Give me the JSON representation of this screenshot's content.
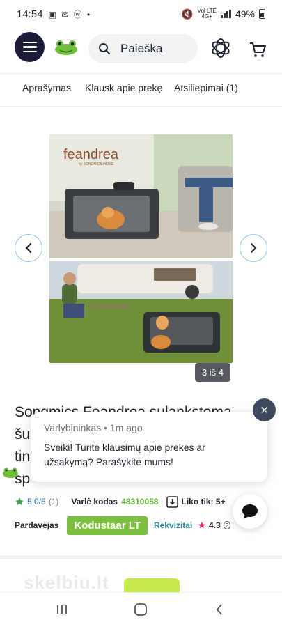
{
  "status_bar": {
    "time": "14:54",
    "network_top": "Vol LTE",
    "network_bottom": "4G+",
    "battery": "49%"
  },
  "header": {
    "search_placeholder": "Paieška"
  },
  "tabs": [
    {
      "label": "Aprašymas"
    },
    {
      "label": "Klausk apie prekę"
    },
    {
      "label": "Atsiliepimai (1)"
    }
  ],
  "gallery": {
    "brand_text": "feandrea",
    "brand_sub": "by SONGMICS HOME",
    "counter": "3 iš 4"
  },
  "product": {
    "title_lines": [
      "Songmics Feandrea sulankstoma",
      "šu",
      "tin",
      "sp"
    ]
  },
  "chat": {
    "sender": "Varlybininkas • 1m ago",
    "message": "Sveiki! Turite klausimų apie prekes ar užsakymą? Parašykite mums!",
    "close_symbol": "✕"
  },
  "meta": {
    "rating": "5.0/5",
    "rating_count": "(1)",
    "code_label": "Varlė kodas",
    "code_value": "48310058",
    "stock_label": "Liko tik: 5+"
  },
  "seller": {
    "label": "Pardavėjas",
    "name": "Kodustaar LT",
    "details_link": "Rekvizitai",
    "score": "4.3",
    "help_symbol": "?"
  },
  "watermark": "skelbiu.lt",
  "colors": {
    "brand_navy": "#1c1d3b",
    "accent_green": "#7cbf3f",
    "rating_blue": "#2c6fb5",
    "star_green": "#3fa34d",
    "seller_star": "#e6245a"
  }
}
